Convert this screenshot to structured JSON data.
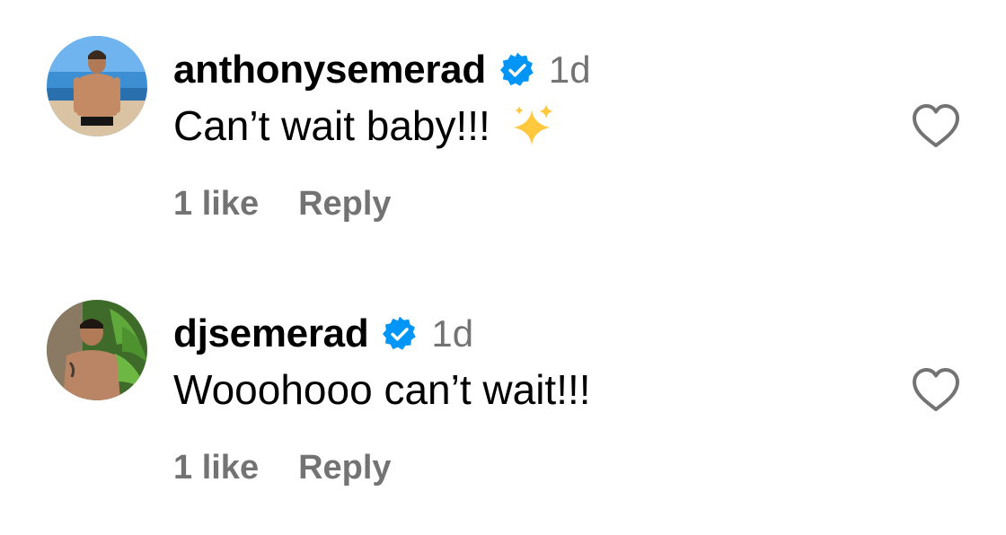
{
  "comments": [
    {
      "username": "anthonysemerad",
      "verified": true,
      "time": "1d",
      "text": "Can’t wait baby!!!",
      "emoji": "sparkles-icon",
      "likes": "1 like",
      "reply": "Reply"
    },
    {
      "username": "djsemerad",
      "verified": true,
      "time": "1d",
      "text": "Wooohooo can’t wait!!!",
      "likes": "1 like",
      "reply": "Reply"
    }
  ],
  "colors": {
    "verified_blue": "#0095F6",
    "secondary_text": "#737373",
    "primary_text": "#000000",
    "sparkle_yellow": "#FFC83D"
  }
}
